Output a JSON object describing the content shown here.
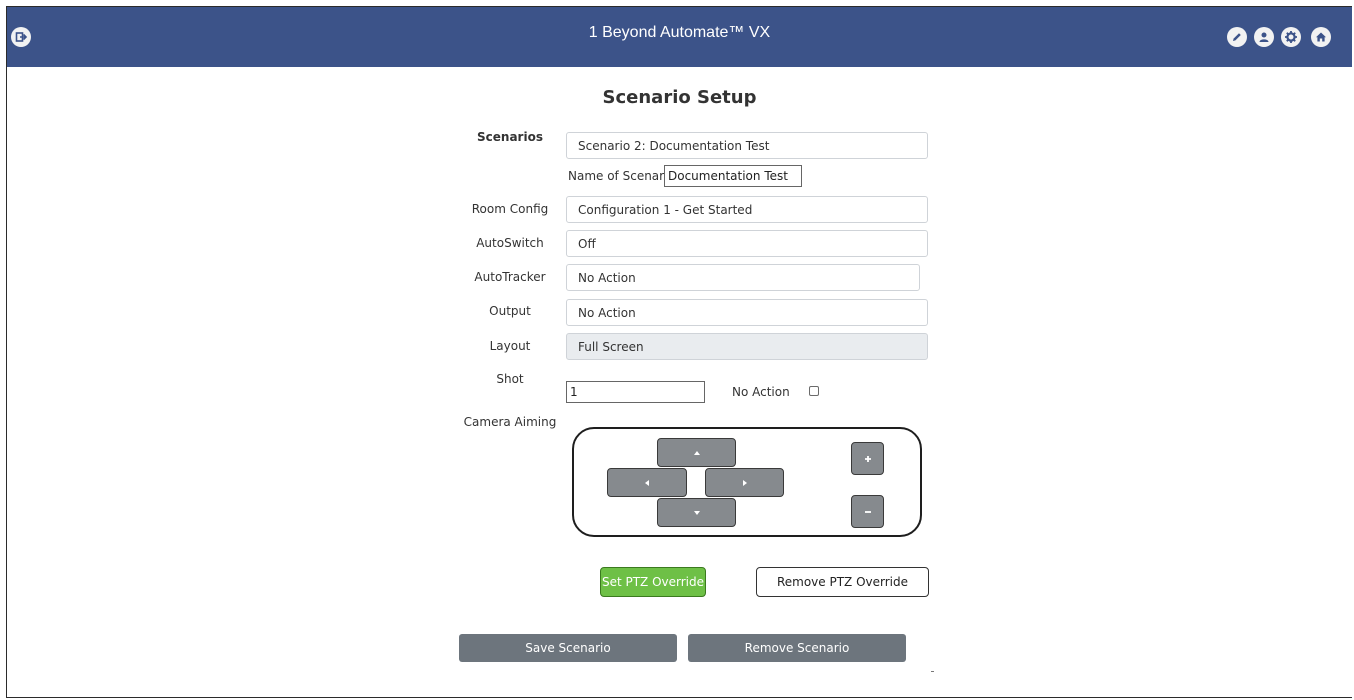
{
  "app": {
    "title": "1 Beyond Automate™ VX",
    "header_bg": "#3c5389",
    "icons": [
      "exit-icon",
      "pencil-icon",
      "user-icon",
      "gear-icon",
      "home-icon"
    ]
  },
  "page": {
    "title": "Scenario Setup"
  },
  "form": {
    "scenarios_label": "Scenarios",
    "scenario_value": "Scenario 2: Documentation Test",
    "name_label": "Name of Scenario",
    "name_value": "Documentation Test",
    "room_config_label": "Room Config",
    "room_config_value": "Configuration 1 - Get Started",
    "autoswitch_label": "AutoSwitch",
    "autoswitch_value": "Off",
    "autotracker_label": "AutoTracker",
    "autotracker_value": "No Action",
    "output_label": "Output",
    "output_value": "No Action",
    "layout_label": "Layout",
    "layout_value": "Full Screen",
    "shot_label": "Shot",
    "shot_value": "1",
    "no_action_label": "No Action",
    "no_action_checked": false,
    "camera_aiming_label": "Camera Aiming"
  },
  "ptz": {
    "up_icon": "caret-up-icon",
    "left_icon": "caret-left-icon",
    "right_icon": "caret-right-icon",
    "down_icon": "caret-down-icon",
    "zoom_in_icon": "plus-icon",
    "zoom_out_icon": "minus-icon",
    "set_override_label": "Set PTZ Override",
    "remove_override_label": "Remove PTZ Override",
    "set_override_color": "#6ec046"
  },
  "actions": {
    "save_label": "Save Scenario",
    "remove_label": "Remove Scenario",
    "button_color": "#6d757d"
  }
}
